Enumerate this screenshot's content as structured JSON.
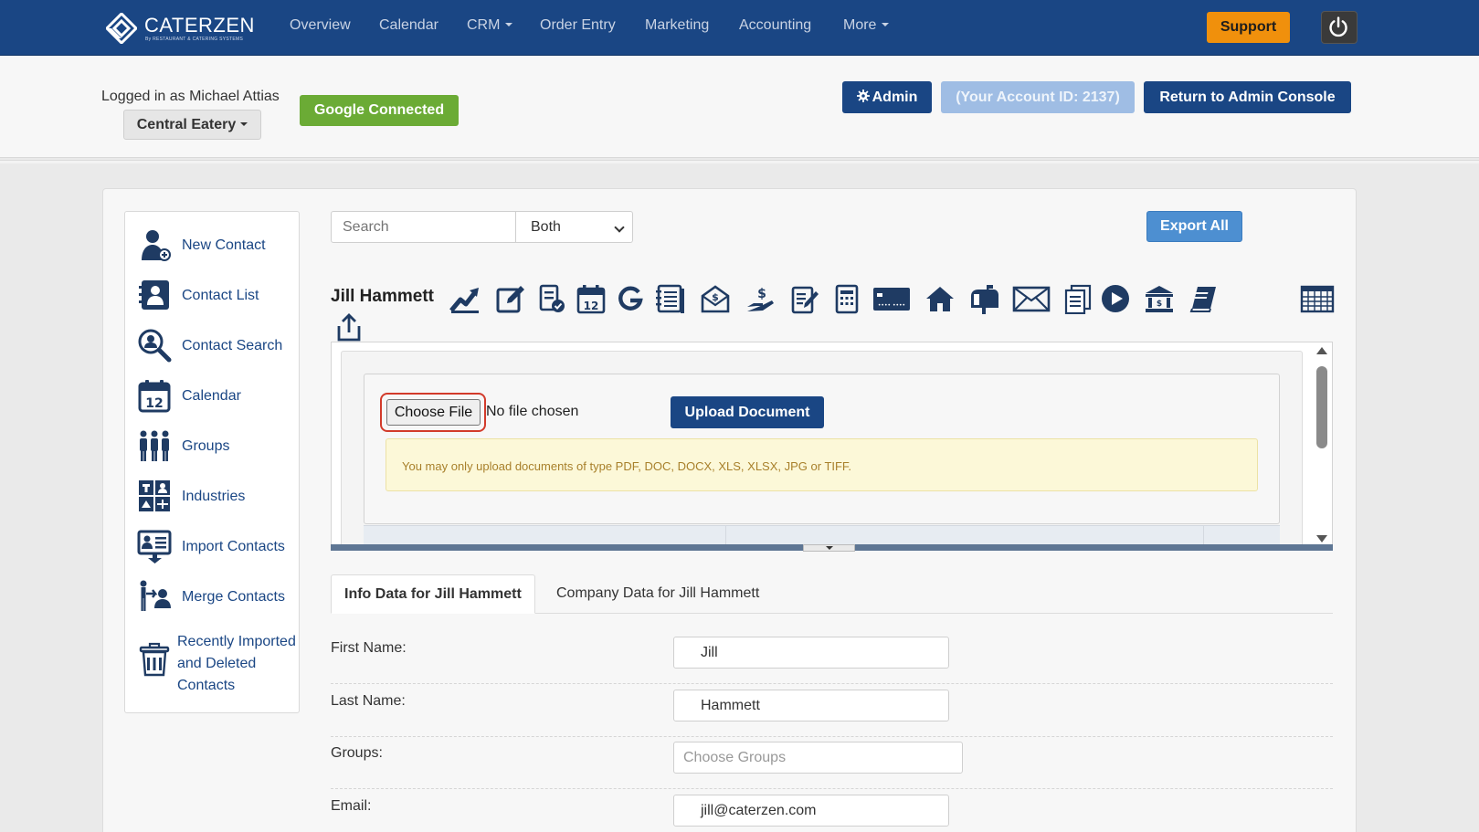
{
  "brand": {
    "name": "CATERZEN",
    "tagline": "By RESTAURANT & CATERING SYSTEMS"
  },
  "nav": {
    "items": [
      {
        "label": "Overview"
      },
      {
        "label": "Calendar"
      },
      {
        "label": "CRM",
        "dropdown": true
      },
      {
        "label": "Order Entry"
      },
      {
        "label": "Marketing"
      },
      {
        "label": "Accounting"
      },
      {
        "label": "More",
        "dropdown": true
      }
    ],
    "support_label": "Support",
    "power_icon": "power-icon"
  },
  "topbar": {
    "logged_in": "Logged in as Michael Attias",
    "restaurant": "Central Eatery",
    "google": "Google Connected",
    "admin": "Admin",
    "account": "(Your Account ID: 2137)",
    "return": "Return to Admin Console"
  },
  "sidebar": {
    "items": [
      {
        "label": "New Contact",
        "icon": "new-contact-icon"
      },
      {
        "label": "Contact List",
        "icon": "contact-list-icon"
      },
      {
        "label": "Contact Search",
        "icon": "contact-search-icon"
      },
      {
        "label": "Calendar",
        "icon": "calendar-icon"
      },
      {
        "label": "Groups",
        "icon": "groups-icon"
      },
      {
        "label": "Industries",
        "icon": "industries-icon"
      },
      {
        "label": "Import Contacts",
        "icon": "import-contacts-icon"
      },
      {
        "label": "Merge Contacts",
        "icon": "merge-contacts-icon"
      },
      {
        "label": "Recently Imported and Deleted Contacts",
        "icon": "trash-icon"
      }
    ]
  },
  "search": {
    "placeholder": "Search",
    "scope": "Both",
    "export_label": "Export All"
  },
  "contact": {
    "name": "Jill Hammett"
  },
  "toolbar_icons": [
    "trend-chart-icon",
    "edit-icon",
    "order-verified-icon",
    "calendar-12-icon",
    "google-icon",
    "ledger-icon",
    "invoice-icon",
    "payment-hand-icon",
    "notes-icon",
    "document-icon",
    "credit-card-icon",
    "home-icon",
    "mailbox-icon",
    "envelope-icon",
    "copy-documents-icon",
    "play-icon",
    "bank-icon",
    "book-icon",
    "grid-table-icon",
    "share-upload-icon"
  ],
  "upload": {
    "choose_file": "Choose File",
    "no_file": "No file chosen",
    "upload_button": "Upload Document",
    "notice": "You may only upload documents of type PDF, DOC, DOCX, XLS, XLSX, JPG or TIFF."
  },
  "tabs": [
    {
      "label": "Info Data for Jill Hammett",
      "active": true
    },
    {
      "label": "Company Data for Jill Hammett",
      "active": false
    }
  ],
  "form": {
    "first_name_label": "First Name:",
    "first_name": "Jill",
    "last_name_label": "Last Name:",
    "last_name": "Hammett",
    "groups_label": "Groups:",
    "groups_placeholder": "Choose Groups",
    "email_label": "Email:",
    "email": "jill@caterzen.com"
  },
  "colors": {
    "nav_bg": "#1a4684",
    "support": "#f0900c",
    "google": "#6bab35",
    "accent": "#1a4684",
    "highlight_ring": "#d23b2b"
  }
}
